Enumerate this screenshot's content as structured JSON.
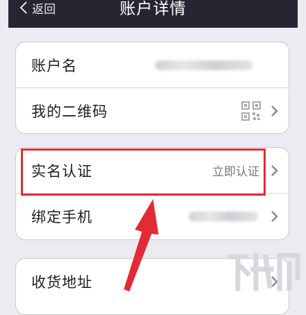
{
  "nav": {
    "back_label": "返回",
    "title": "账户详情"
  },
  "groups": [
    {
      "rows": [
        {
          "label": "账户名",
          "value_visible": "blurred"
        },
        {
          "label": "我的二维码",
          "icon": "qr-code-icon"
        }
      ]
    },
    {
      "rows": [
        {
          "label": "实名认证",
          "status": "立即认证"
        },
        {
          "label": "绑定手机",
          "value_visible": "blurred"
        }
      ]
    },
    {
      "rows": [
        {
          "label": "收货地址"
        }
      ]
    }
  ],
  "colors": {
    "nav_bg": "#252632",
    "page_bg": "#ebebf1",
    "highlight": "#e12c35"
  },
  "icons": [
    "chevron-left-icon",
    "chevron-right-icon",
    "qr-code-icon",
    "pointer-arrow-icon",
    "watermark-logo"
  ]
}
